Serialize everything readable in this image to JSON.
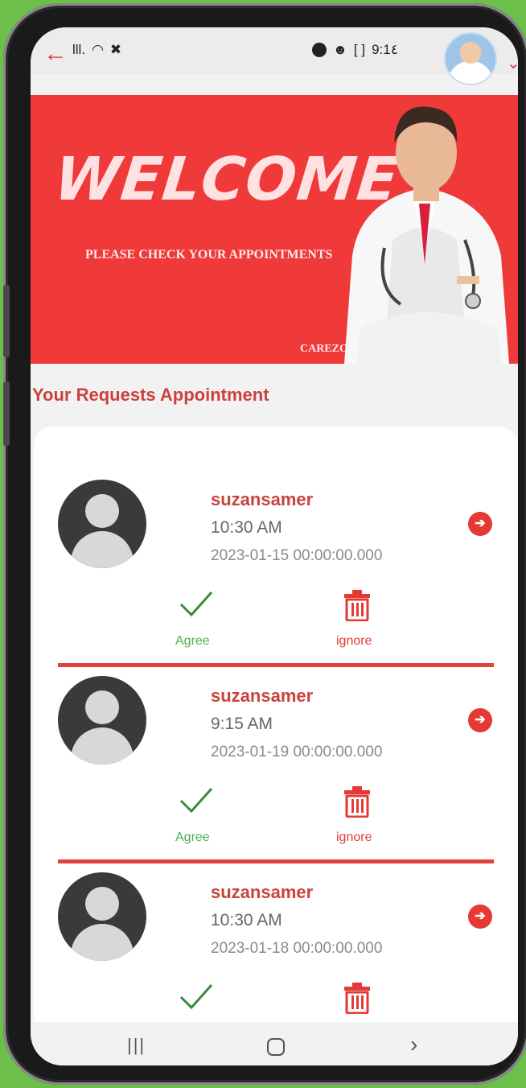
{
  "status_bar": {
    "signal_text": "lll.",
    "time": "9:1٤"
  },
  "banner": {
    "welcome": "WELCOME",
    "subtitle": "PLEASE CHECK YOUR APPOINTMENTS",
    "brand": "CAREZONE"
  },
  "section_title": "Your Requests Appointment",
  "appointments": [
    {
      "name": "suzansamer",
      "time": "10:30 AM",
      "date": "2023-01-15 00:00:00.000",
      "agree_label": "Agree",
      "ignore_label": "ignore"
    },
    {
      "name": "suzansamer",
      "time": "9:15 AM",
      "date": "2023-01-19 00:00:00.000",
      "agree_label": "Agree",
      "ignore_label": "ignore"
    },
    {
      "name": "suzansamer",
      "time": "10:30 AM",
      "date": "2023-01-18 00:00:00.000"
    }
  ],
  "nav_bar": {
    "recents_icon": "recents-icon",
    "home_icon": "home-icon",
    "back_icon": "back-icon"
  },
  "colors": {
    "accent": "#e53935",
    "banner": "#f03a3a",
    "agree": "#4caf50",
    "background": "#6cc04a"
  }
}
